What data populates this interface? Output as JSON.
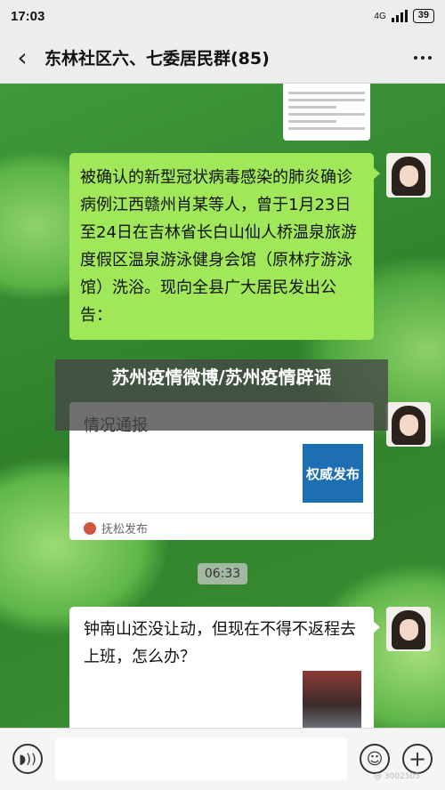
{
  "status_bar": {
    "time": "17:03",
    "network": "4G",
    "battery": "39"
  },
  "header": {
    "back_icon": "back-arrow",
    "title": "东林社区六、七委居民群(85)",
    "more_icon": "more-dots"
  },
  "messages": {
    "msg1": {
      "text": "被确认的新型冠状病毒感染的肺炎确诊病例江西赣州肖某等人，曾于1月23日至24日在吉林省长白山仙人桥温泉旅游度假区温泉游泳健身会馆（原林疗游泳馆）洗浴。现向全县广大居民发出公告："
    },
    "card": {
      "header": "情况通报",
      "thumb_text": "权威发布",
      "source": "抚松发布"
    },
    "timestamp": "06:33",
    "msg2": {
      "text": "钟南山还没让动，但现在不得不返程去上班，怎么办？"
    }
  },
  "overlay": {
    "headline": "苏州疫情微博/苏州疫情辟谣"
  },
  "watermark": "@ 3002505",
  "colors": {
    "green_bubble": "#a0e75a",
    "bar_bg": "#ededed",
    "thumb_blue": "#1e6fb2"
  }
}
